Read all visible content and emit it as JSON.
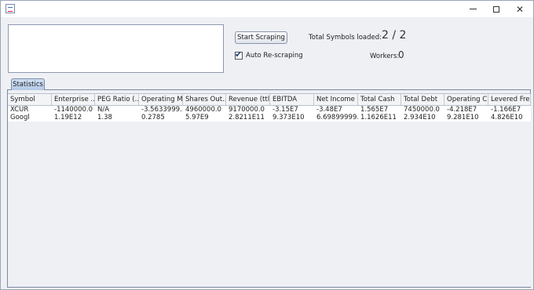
{
  "window": {
    "title": ""
  },
  "controls": {
    "start_button": "Start Scraping",
    "total_label": "Total Symbols loaded:",
    "total_value": "2 / 2",
    "auto_label": "Auto Re-scraping",
    "auto_checked": true,
    "workers_label": "Workers:",
    "workers_value": "0"
  },
  "tabs": [
    {
      "label": "Statistics"
    }
  ],
  "table": {
    "columns": [
      "Symbol",
      "Enterprise ...",
      "PEG Ratio (...",
      "Operating M...",
      "Shares Out...",
      "Revenue (ttl...",
      "EBITDA",
      "Net Income",
      "Total Cash",
      "Total Debt",
      "Operating C...",
      "Levered Fre..."
    ],
    "rows": [
      [
        "XCUR",
        "-1140000.0",
        "N/A",
        "-3.5633999...",
        "4960000.0",
        "9170000.0",
        "-3.15E7",
        "-3.48E7",
        "1.565E7",
        "7450000.0",
        "-4.218E7",
        "-1.166E7"
      ],
      [
        "Googl",
        "1.19E12",
        "1.38",
        "0.2785",
        "5.97E9",
        "2.8211E11",
        "9.373E10",
        "6.69899999...",
        "1.1626E11",
        "2.934E10",
        "9.281E10",
        "4.826E10"
      ]
    ]
  }
}
